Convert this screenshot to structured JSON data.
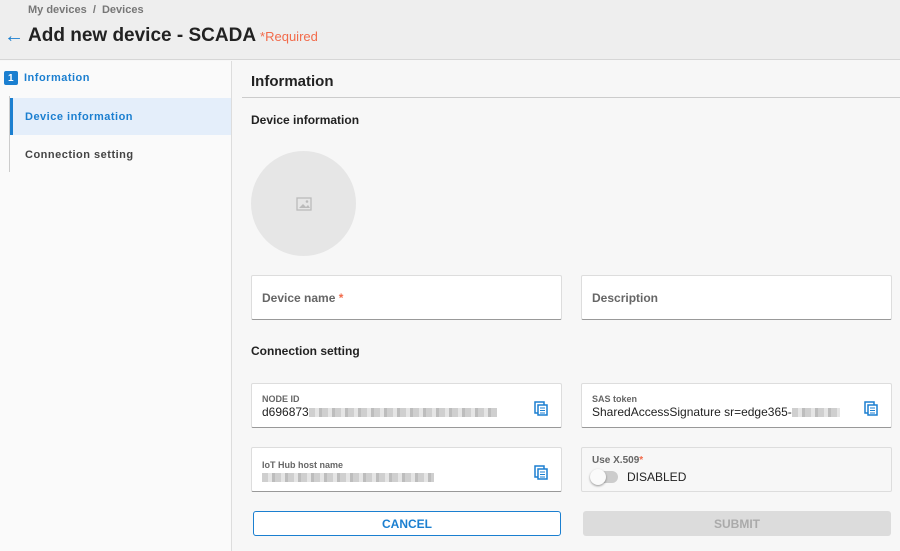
{
  "breadcrumb": [
    "My devices",
    "Devices"
  ],
  "title": "Add new device - SCADA",
  "required": "*Required",
  "sidebar": {
    "step_number": "1",
    "step_label": "Information",
    "items": [
      {
        "label": "Device information"
      },
      {
        "label": "Connection setting"
      }
    ]
  },
  "main": {
    "heading": "Information",
    "device_info_heading": "Device information",
    "connection_heading": "Connection setting",
    "device_name_label": "Device name",
    "description_label": "Description",
    "node_id_label": "NODE ID",
    "node_id_value": "d696873",
    "sas_label": "SAS token",
    "sas_value": "SharedAccessSignature sr=edge365-",
    "iot_label": "IoT Hub host name",
    "x509_label": "Use X.509",
    "x509_state": "DISABLED",
    "cancel": "CANCEL",
    "submit": "SUBMIT"
  }
}
